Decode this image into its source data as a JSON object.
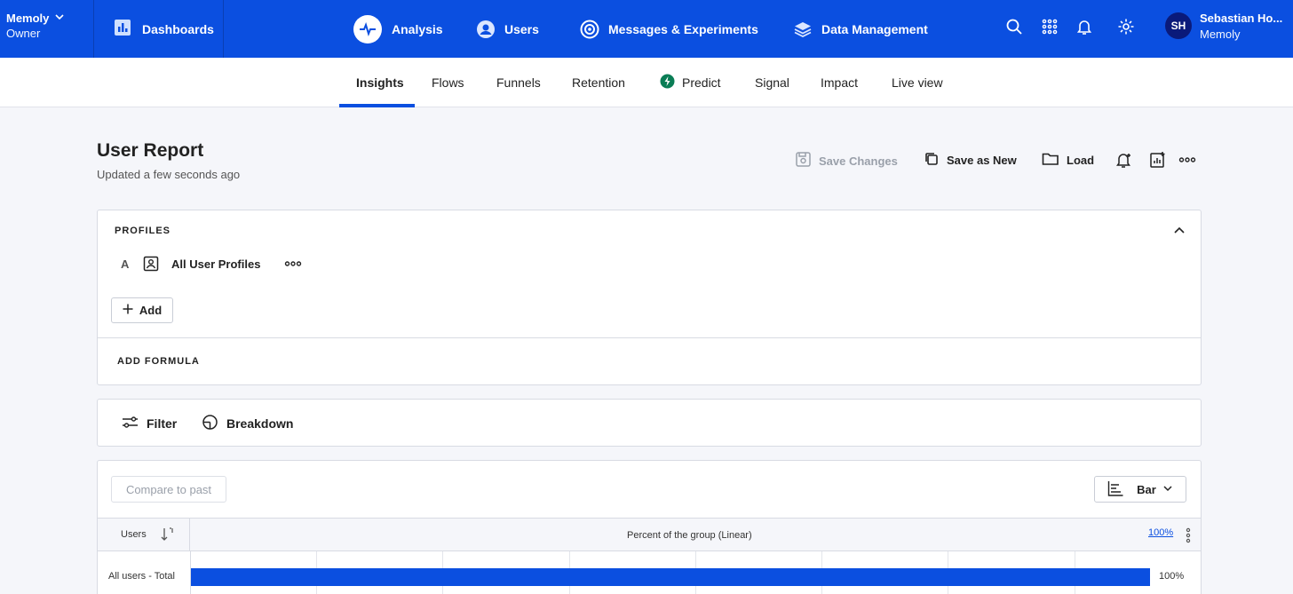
{
  "topbar": {
    "org_name": "Memoly",
    "org_role": "Owner",
    "dashboards": "Dashboards",
    "nav": [
      {
        "label": "Analysis",
        "icon": "analysis-icon"
      },
      {
        "label": "Users",
        "icon": "user-icon"
      },
      {
        "label": "Messages & Experiments",
        "icon": "target-icon"
      },
      {
        "label": "Data Management",
        "icon": "layers-icon"
      }
    ],
    "user_initials": "SH",
    "user_name": "Sebastian Ho...",
    "user_org": "Memoly",
    "colors": {
      "bar": "#0b4fe0",
      "avatar": "#0a1a7a"
    }
  },
  "subnav": {
    "tabs": [
      "Insights",
      "Flows",
      "Funnels",
      "Retention",
      "Predict",
      "Signal",
      "Impact",
      "Live view"
    ],
    "active": "Insights"
  },
  "report": {
    "title": "User Report",
    "updated": "Updated a few seconds ago",
    "save_changes": "Save Changes",
    "save_as_new": "Save as New",
    "load": "Load"
  },
  "profiles": {
    "heading": "PROFILES",
    "row_letter": "A",
    "row_label": "All User Profiles",
    "add": "Add",
    "add_formula": "ADD FORMULA"
  },
  "filters": {
    "filter": "Filter",
    "breakdown": "Breakdown"
  },
  "results": {
    "compare": "Compare to past",
    "chart_type": "Bar",
    "col_users": "Users",
    "col_percent": "Percent of the group (Linear)",
    "scale": "100%",
    "rows": [
      {
        "label": "All users - Total",
        "percent": 100,
        "value_label": "100%"
      }
    ]
  }
}
